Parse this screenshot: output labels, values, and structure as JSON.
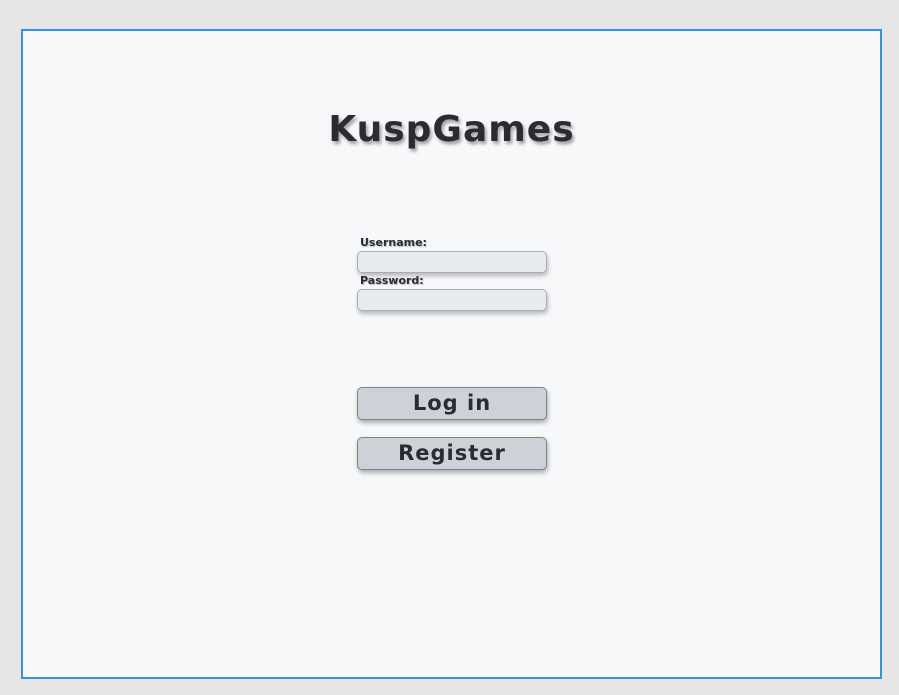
{
  "app": {
    "title": "KuspGames"
  },
  "login_form": {
    "username_label": "Username:",
    "username_value": "",
    "password_label": "Password:",
    "password_value": ""
  },
  "actions": {
    "login_label": "Log in",
    "register_label": "Register"
  },
  "colors": {
    "window_border": "#3593d8",
    "window_background": "#f7f8fa",
    "button_background": "#cdd1d8",
    "text": "#2a2b33"
  }
}
